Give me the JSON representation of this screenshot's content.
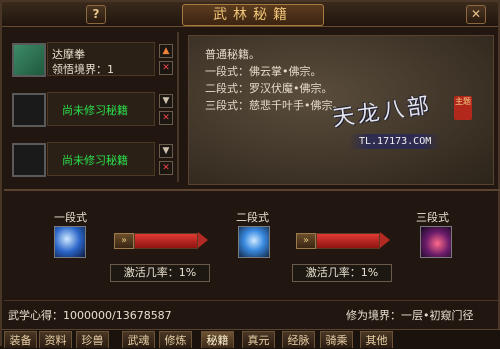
{
  "window": {
    "title": "武林秘籍",
    "help_label": "?",
    "close_label": "✕"
  },
  "slots": [
    {
      "name": "达摩拳",
      "level_label": "领悟境界：1",
      "filled": true
    },
    {
      "name": "尚未修习秘籍",
      "filled": false
    },
    {
      "name": "尚未修习秘籍",
      "filled": false
    }
  ],
  "slot_buttons": {
    "up": "▲",
    "down": "▼",
    "remove": "✕"
  },
  "description": {
    "lines": [
      "普通秘籍。",
      "一段式：佛云掌•佛宗。",
      "二段式：罗汉伏魔•佛宗。",
      "三段式：慈悲千叶手•佛宗。"
    ]
  },
  "watermark": {
    "brand": "天龙八部",
    "stamp": "主题",
    "url": "TL.17173.COM"
  },
  "stages": [
    {
      "label": "一段式",
      "icon": "palm-skill-icon"
    },
    {
      "label": "二段式",
      "icon": "arhat-skill-icon"
    },
    {
      "label": "三段式",
      "icon": "thousand-leaf-skill-icon"
    }
  ],
  "progress": [
    {
      "rate_label": "激活几率：1%",
      "fill": 1.0
    },
    {
      "rate_label": "激活几率：1%",
      "fill": 1.0
    }
  ],
  "stats": {
    "xinde": "武学心得：1000000/13678587",
    "realm": "修为境界：一层•初窥门径"
  },
  "tabs": [
    "装备",
    "资料",
    "珍兽",
    "武魂",
    "修炼",
    "秘籍",
    "真元",
    "经脉",
    "骑乘",
    "其他"
  ],
  "active_tab": "秘籍"
}
